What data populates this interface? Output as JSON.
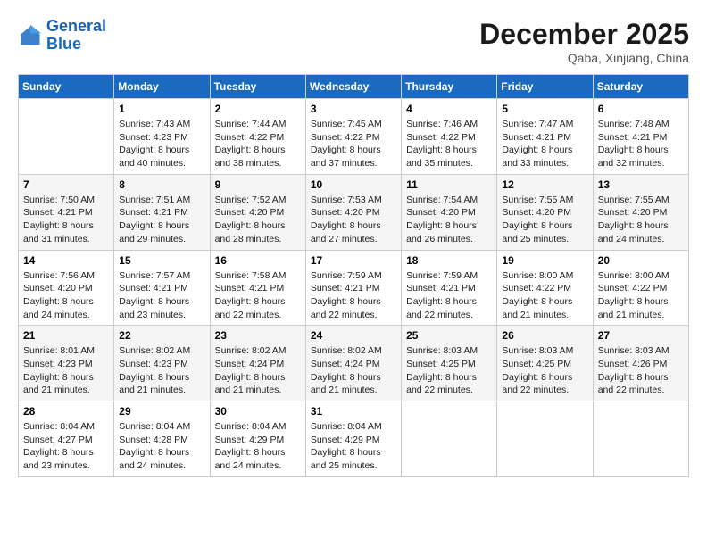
{
  "header": {
    "logo_line1": "General",
    "logo_line2": "Blue",
    "month_title": "December 2025",
    "location": "Qaba, Xinjiang, China"
  },
  "days_of_week": [
    "Sunday",
    "Monday",
    "Tuesday",
    "Wednesday",
    "Thursday",
    "Friday",
    "Saturday"
  ],
  "weeks": [
    [
      {
        "day": "",
        "sunrise": "",
        "sunset": "",
        "daylight": ""
      },
      {
        "day": "1",
        "sunrise": "Sunrise: 7:43 AM",
        "sunset": "Sunset: 4:23 PM",
        "daylight": "Daylight: 8 hours and 40 minutes."
      },
      {
        "day": "2",
        "sunrise": "Sunrise: 7:44 AM",
        "sunset": "Sunset: 4:22 PM",
        "daylight": "Daylight: 8 hours and 38 minutes."
      },
      {
        "day": "3",
        "sunrise": "Sunrise: 7:45 AM",
        "sunset": "Sunset: 4:22 PM",
        "daylight": "Daylight: 8 hours and 37 minutes."
      },
      {
        "day": "4",
        "sunrise": "Sunrise: 7:46 AM",
        "sunset": "Sunset: 4:22 PM",
        "daylight": "Daylight: 8 hours and 35 minutes."
      },
      {
        "day": "5",
        "sunrise": "Sunrise: 7:47 AM",
        "sunset": "Sunset: 4:21 PM",
        "daylight": "Daylight: 8 hours and 33 minutes."
      },
      {
        "day": "6",
        "sunrise": "Sunrise: 7:48 AM",
        "sunset": "Sunset: 4:21 PM",
        "daylight": "Daylight: 8 hours and 32 minutes."
      }
    ],
    [
      {
        "day": "7",
        "sunrise": "Sunrise: 7:50 AM",
        "sunset": "Sunset: 4:21 PM",
        "daylight": "Daylight: 8 hours and 31 minutes."
      },
      {
        "day": "8",
        "sunrise": "Sunrise: 7:51 AM",
        "sunset": "Sunset: 4:21 PM",
        "daylight": "Daylight: 8 hours and 29 minutes."
      },
      {
        "day": "9",
        "sunrise": "Sunrise: 7:52 AM",
        "sunset": "Sunset: 4:20 PM",
        "daylight": "Daylight: 8 hours and 28 minutes."
      },
      {
        "day": "10",
        "sunrise": "Sunrise: 7:53 AM",
        "sunset": "Sunset: 4:20 PM",
        "daylight": "Daylight: 8 hours and 27 minutes."
      },
      {
        "day": "11",
        "sunrise": "Sunrise: 7:54 AM",
        "sunset": "Sunset: 4:20 PM",
        "daylight": "Daylight: 8 hours and 26 minutes."
      },
      {
        "day": "12",
        "sunrise": "Sunrise: 7:55 AM",
        "sunset": "Sunset: 4:20 PM",
        "daylight": "Daylight: 8 hours and 25 minutes."
      },
      {
        "day": "13",
        "sunrise": "Sunrise: 7:55 AM",
        "sunset": "Sunset: 4:20 PM",
        "daylight": "Daylight: 8 hours and 24 minutes."
      }
    ],
    [
      {
        "day": "14",
        "sunrise": "Sunrise: 7:56 AM",
        "sunset": "Sunset: 4:20 PM",
        "daylight": "Daylight: 8 hours and 24 minutes."
      },
      {
        "day": "15",
        "sunrise": "Sunrise: 7:57 AM",
        "sunset": "Sunset: 4:21 PM",
        "daylight": "Daylight: 8 hours and 23 minutes."
      },
      {
        "day": "16",
        "sunrise": "Sunrise: 7:58 AM",
        "sunset": "Sunset: 4:21 PM",
        "daylight": "Daylight: 8 hours and 22 minutes."
      },
      {
        "day": "17",
        "sunrise": "Sunrise: 7:59 AM",
        "sunset": "Sunset: 4:21 PM",
        "daylight": "Daylight: 8 hours and 22 minutes."
      },
      {
        "day": "18",
        "sunrise": "Sunrise: 7:59 AM",
        "sunset": "Sunset: 4:21 PM",
        "daylight": "Daylight: 8 hours and 22 minutes."
      },
      {
        "day": "19",
        "sunrise": "Sunrise: 8:00 AM",
        "sunset": "Sunset: 4:22 PM",
        "daylight": "Daylight: 8 hours and 21 minutes."
      },
      {
        "day": "20",
        "sunrise": "Sunrise: 8:00 AM",
        "sunset": "Sunset: 4:22 PM",
        "daylight": "Daylight: 8 hours and 21 minutes."
      }
    ],
    [
      {
        "day": "21",
        "sunrise": "Sunrise: 8:01 AM",
        "sunset": "Sunset: 4:23 PM",
        "daylight": "Daylight: 8 hours and 21 minutes."
      },
      {
        "day": "22",
        "sunrise": "Sunrise: 8:02 AM",
        "sunset": "Sunset: 4:23 PM",
        "daylight": "Daylight: 8 hours and 21 minutes."
      },
      {
        "day": "23",
        "sunrise": "Sunrise: 8:02 AM",
        "sunset": "Sunset: 4:24 PM",
        "daylight": "Daylight: 8 hours and 21 minutes."
      },
      {
        "day": "24",
        "sunrise": "Sunrise: 8:02 AM",
        "sunset": "Sunset: 4:24 PM",
        "daylight": "Daylight: 8 hours and 21 minutes."
      },
      {
        "day": "25",
        "sunrise": "Sunrise: 8:03 AM",
        "sunset": "Sunset: 4:25 PM",
        "daylight": "Daylight: 8 hours and 22 minutes."
      },
      {
        "day": "26",
        "sunrise": "Sunrise: 8:03 AM",
        "sunset": "Sunset: 4:25 PM",
        "daylight": "Daylight: 8 hours and 22 minutes."
      },
      {
        "day": "27",
        "sunrise": "Sunrise: 8:03 AM",
        "sunset": "Sunset: 4:26 PM",
        "daylight": "Daylight: 8 hours and 22 minutes."
      }
    ],
    [
      {
        "day": "28",
        "sunrise": "Sunrise: 8:04 AM",
        "sunset": "Sunset: 4:27 PM",
        "daylight": "Daylight: 8 hours and 23 minutes."
      },
      {
        "day": "29",
        "sunrise": "Sunrise: 8:04 AM",
        "sunset": "Sunset: 4:28 PM",
        "daylight": "Daylight: 8 hours and 24 minutes."
      },
      {
        "day": "30",
        "sunrise": "Sunrise: 8:04 AM",
        "sunset": "Sunset: 4:29 PM",
        "daylight": "Daylight: 8 hours and 24 minutes."
      },
      {
        "day": "31",
        "sunrise": "Sunrise: 8:04 AM",
        "sunset": "Sunset: 4:29 PM",
        "daylight": "Daylight: 8 hours and 25 minutes."
      },
      {
        "day": "",
        "sunrise": "",
        "sunset": "",
        "daylight": ""
      },
      {
        "day": "",
        "sunrise": "",
        "sunset": "",
        "daylight": ""
      },
      {
        "day": "",
        "sunrise": "",
        "sunset": "",
        "daylight": ""
      }
    ]
  ]
}
